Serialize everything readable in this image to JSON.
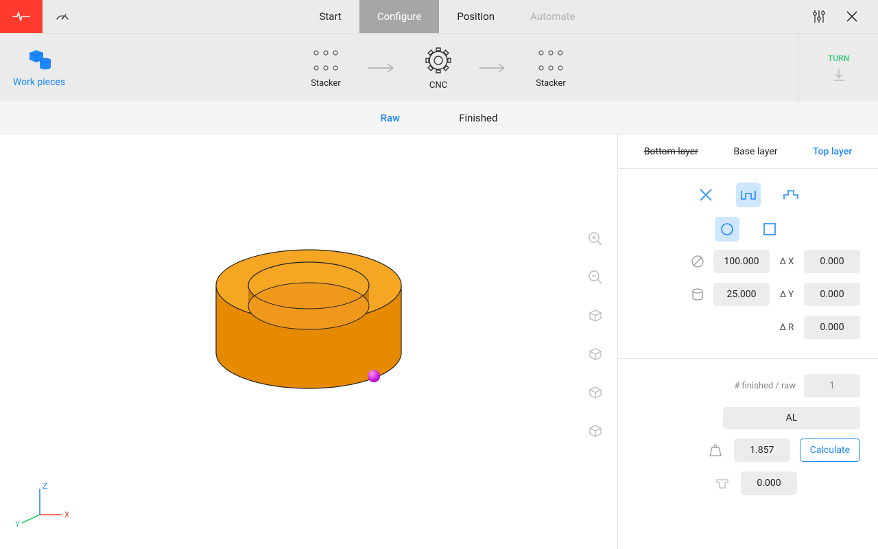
{
  "topnav": {
    "tabs": {
      "start": "Start",
      "configure": "Configure",
      "position": "Position",
      "automate": "Automate"
    }
  },
  "sidebar": {
    "workpieces": "Work pieces"
  },
  "process": {
    "stacker_in": "Stacker",
    "cnc": "CNC",
    "stacker_out": "Stacker",
    "turn": "TURN"
  },
  "subtabs": {
    "raw": "Raw",
    "finished": "Finished"
  },
  "layers": {
    "bottom": "Bottom layer",
    "base": "Base layer",
    "top": "Top layer"
  },
  "dims": {
    "diameter": "100.000",
    "height": "25.000",
    "dx_label": "Δ X",
    "dx": "0.000",
    "dy_label": "Δ Y",
    "dy": "0.000",
    "dr_label": "Δ R",
    "dr": "0.000"
  },
  "lower": {
    "ratio_label": "# finished / raw",
    "ratio_value": "1",
    "material": "AL",
    "weight": "1.857",
    "calculate": "Calculate",
    "extra": "0.000"
  },
  "axes": {
    "x": "X",
    "y": "Y",
    "z": "Z"
  }
}
